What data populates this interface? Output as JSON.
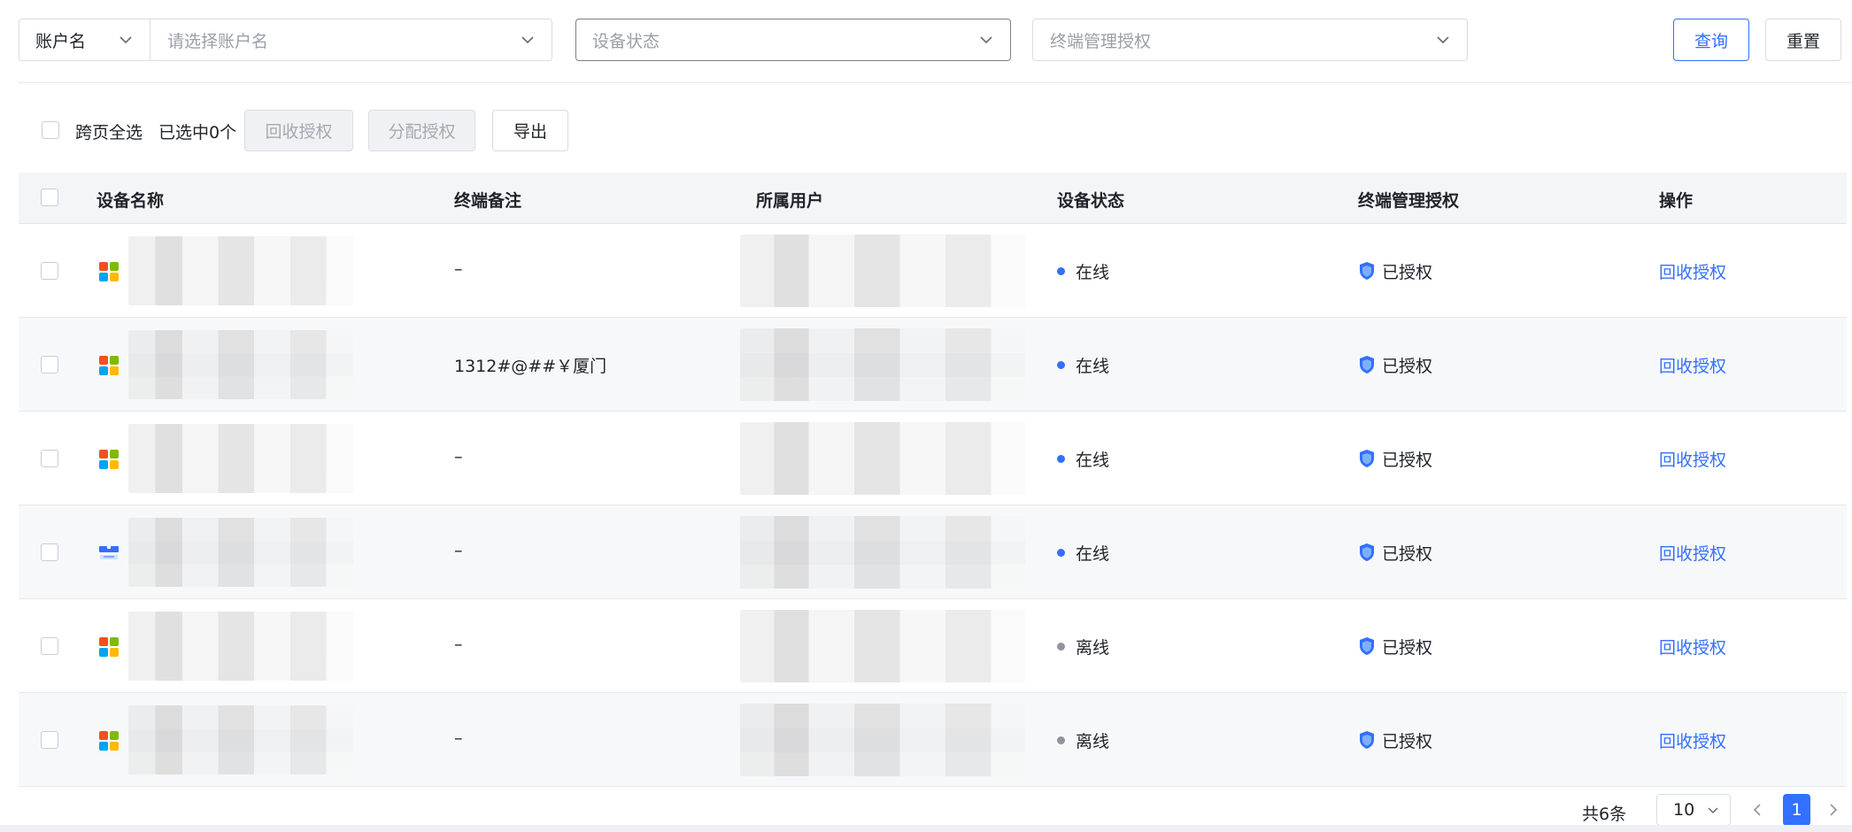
{
  "filters": {
    "account_type": "账户名",
    "account_placeholder": "请选择账户名",
    "status_placeholder": "设备状态",
    "auth_placeholder": "终端管理授权",
    "query_label": "查询",
    "reset_label": "重置"
  },
  "toolbar": {
    "cross_page_select": "跨页全选",
    "selected_count": "已选中0个",
    "recycle_label": "回收授权",
    "assign_label": "分配授权",
    "export_label": "导出"
  },
  "table": {
    "headers": [
      "设备名称",
      "终端备注",
      "所属用户",
      "设备状态",
      "终端管理授权",
      "操作"
    ],
    "rows": [
      {
        "os": "windows-icon",
        "remark": "–",
        "status": "在线",
        "status_type": "online",
        "auth": "已授权",
        "action": "回收授权"
      },
      {
        "os": "windows-icon",
        "remark": "1312#@##￥厦门",
        "status": "在线",
        "status_type": "online",
        "auth": "已授权",
        "action": "回收授权"
      },
      {
        "os": "windows-icon",
        "remark": "–",
        "status": "在线",
        "status_type": "online",
        "auth": "已授权",
        "action": "回收授权"
      },
      {
        "os": "uos-icon",
        "remark": "–",
        "status": "在线",
        "status_type": "online",
        "auth": "已授权",
        "action": "回收授权"
      },
      {
        "os": "windows-icon",
        "remark": "–",
        "status": "离线",
        "status_type": "offline",
        "auth": "已授权",
        "action": "回收授权"
      },
      {
        "os": "windows-icon",
        "remark": "–",
        "status": "离线",
        "status_type": "offline",
        "auth": "已授权",
        "action": "回收授权"
      }
    ]
  },
  "pagination": {
    "total": "共6条",
    "page_size": "10",
    "current_page": "1"
  },
  "colors": {
    "primary": "#3370ff",
    "online": "#3370ff",
    "offline": "#8f959e"
  }
}
